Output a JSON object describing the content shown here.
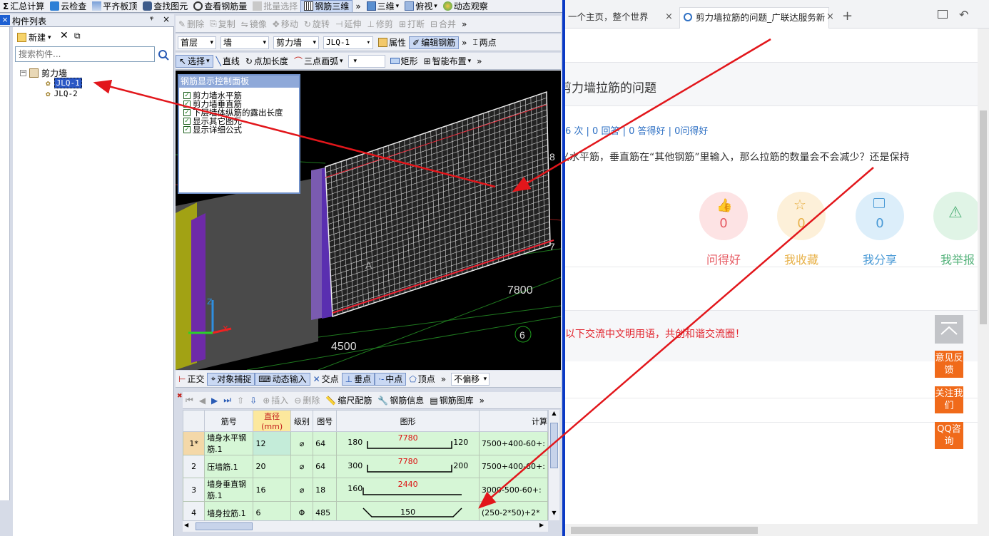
{
  "app": {
    "toolbar": [
      {
        "icon": "sum-icon",
        "label": "汇总计算"
      },
      {
        "icon": "cloud-check-icon",
        "label": "云检查"
      },
      {
        "icon": "flat-slab-top-icon",
        "label": "平齐板顶"
      },
      {
        "icon": "binoculars-icon",
        "label": "查找图元"
      },
      {
        "icon": "rebar-qty-icon",
        "label": "查看钢筋量"
      },
      {
        "icon": "batch-select-icon",
        "label": "批量选择"
      },
      {
        "icon": "rebar-3d-icon",
        "label": "钢筋三维"
      },
      {
        "icon": "cube-icon",
        "label": "三维"
      },
      {
        "icon": "top-view-icon",
        "label": "俯视"
      },
      {
        "icon": "orbit-icon",
        "label": "动态观察"
      }
    ],
    "panel": {
      "title": "构件列表",
      "pin": "ᵠ",
      "new_label": "新建",
      "search_placeholder": "搜索构件...",
      "tree_root": "剪力墙",
      "tree_items": [
        "JLQ-1",
        "JLQ-2"
      ]
    },
    "edit_bar": [
      "删除",
      "复制",
      "镜像",
      "移动",
      "旋转",
      "延伸",
      "修剪",
      "打断",
      "合并"
    ],
    "prop_bar": {
      "floor": "首层",
      "category": "墙",
      "type": "剪力墙",
      "component": "JLQ-1",
      "attr_label": "属性",
      "edit_rebar_label": "编辑钢筋",
      "two_points": "两点"
    },
    "draw_bar": {
      "select": "选择",
      "line": "直线",
      "point_len": "点加长度",
      "arc3": "三点画弧",
      "rect": "矩形",
      "smart": "智能布置"
    },
    "control_panel": {
      "title": "钢筋显示控制面板",
      "options": [
        "剪力墙水平筋",
        "剪力墙垂直筋",
        "下层墙体纵筋的露出长度",
        "显示其它图元",
        "显示详细公式"
      ]
    },
    "viewport": {
      "dim_7800": "7800",
      "dim_4500": "4500",
      "axis_6": "6",
      "axis_7": "7",
      "axis_8": "8",
      "axis_A": "A",
      "axis_z": "Z",
      "axis_x": "X"
    },
    "snap_bar": {
      "ortho": "正交",
      "snap": "对象捕捉",
      "dyn": "动态输入",
      "intersect": "交点",
      "perp": "垂点",
      "mid": "中点",
      "vertex": "顶点",
      "offset": "不偏移"
    },
    "rebar_bar": {
      "insert": "插入",
      "delete": "删除",
      "scale": "缩尺配筋",
      "info": "钢筋信息",
      "lib": "钢筋图库"
    },
    "table": {
      "headers": [
        "",
        "筋号",
        "直径(mm)",
        "级别",
        "图号",
        "图形",
        "计算"
      ],
      "rows": [
        {
          "no": "1*",
          "name": "墙身水平钢筋.1",
          "dia": "12",
          "grade": "⌀",
          "fig": "64",
          "left": "180",
          "mid": "7780",
          "right": "120",
          "calc": "7500+400-60+:"
        },
        {
          "no": "2",
          "name": "压墙筋.1",
          "dia": "20",
          "grade": "⌀",
          "fig": "64",
          "left": "300",
          "mid": "7780",
          "right": "200",
          "calc": "7500+400-60+:"
        },
        {
          "no": "3",
          "name": "墙身垂直钢筋.1",
          "dia": "16",
          "grade": "⌀",
          "fig": "18",
          "left": "160",
          "mid": "2440",
          "right": "",
          "calc": "3000-500-60+:"
        },
        {
          "no": "4",
          "name": "墙身拉筋.1",
          "dia": "6",
          "grade": "Φ",
          "fig": "485",
          "left": "",
          "mid": "150",
          "right": "",
          "calc": "(250-2*50)+2*"
        }
      ]
    }
  },
  "browser": {
    "tabs": [
      {
        "label": "一个主页，整个世界"
      },
      {
        "label": "剪力墙拉筋的问题_广联达服务新"
      }
    ],
    "question": {
      "title": "剪力墙拉筋的问题",
      "stats": "6 次 | 0 回答 | 0 答得好 | 0问得好",
      "body": "义水平筋，垂直筋在“其他钢筋”里输入，那么拉筋的数量会不会减少？还是保持"
    },
    "actions": [
      {
        "count": "0",
        "label": "问得好",
        "color": "#e65a62",
        "bg": "#fde3e4"
      },
      {
        "count": "0",
        "label": "我收藏",
        "color": "#e8b24a",
        "bg": "#fdf0d9"
      },
      {
        "count": "0",
        "label": "我分享",
        "color": "#4a9ad6",
        "bg": "#dceefa"
      },
      {
        "count": "",
        "label": "我举报",
        "color": "#53b27a",
        "bg": "#e0f4e6"
      }
    ],
    "notice": "以下交流中文明用语，共创和谐交流圈！",
    "side": [
      "意见反馈",
      "关注我们",
      "QQ咨询"
    ]
  },
  "colors": {
    "annotation_arrow": "#e2161b",
    "highlight_header": "#fce89d",
    "row_green": "#d6f6d6"
  }
}
